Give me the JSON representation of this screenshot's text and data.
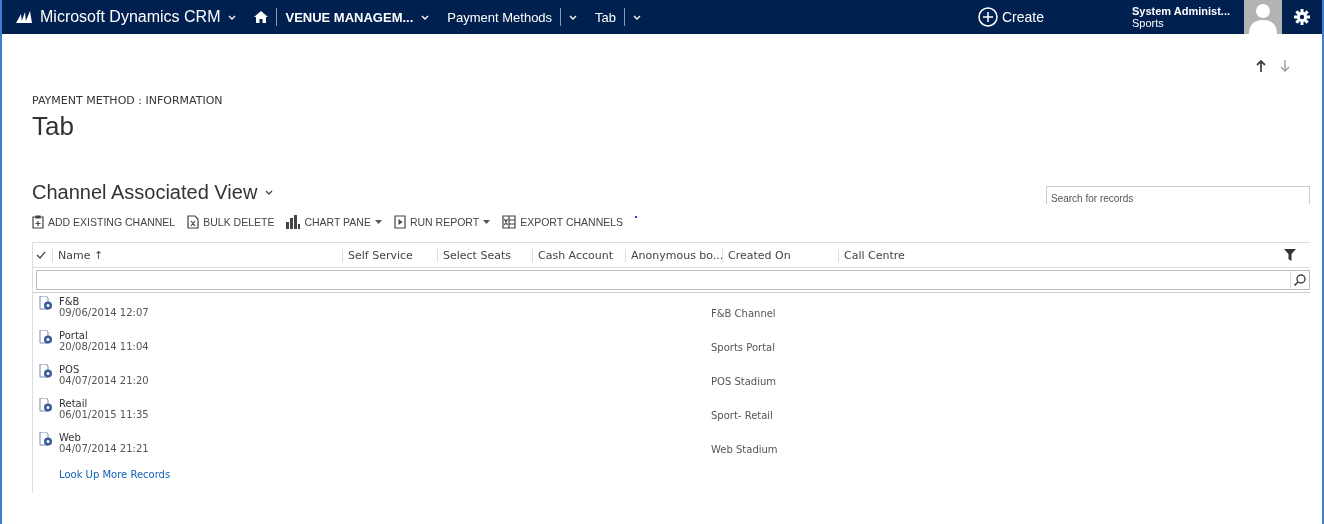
{
  "nav": {
    "app": "Microsoft Dynamics CRM",
    "area": "VENUE MANAGEM...",
    "entity": "Payment Methods",
    "record": "Tab",
    "create": "Create",
    "user": "System Administ...",
    "org": "Sports"
  },
  "record": {
    "entity_label": "PAYMENT METHOD : INFORMATION",
    "title": "Tab"
  },
  "view": {
    "title": "Channel Associated View",
    "search": {
      "placeholder": "Search for records"
    }
  },
  "commands": [
    {
      "label": "ADD EXISTING CHANNEL",
      "kind": "add",
      "dropdown": false
    },
    {
      "label": "BULK DELETE",
      "kind": "delete",
      "dropdown": false
    },
    {
      "label": "CHART PANE",
      "kind": "chart",
      "dropdown": true
    },
    {
      "label": "RUN REPORT",
      "kind": "report",
      "dropdown": true
    },
    {
      "label": "EXPORT CHANNELS",
      "kind": "export",
      "dropdown": false
    }
  ],
  "table": {
    "columns": [
      {
        "label": "Name ↑"
      },
      {
        "label": "Self Service"
      },
      {
        "label": "Select Seats"
      },
      {
        "label": "Cash Account"
      },
      {
        "label": "Anonymous bo..."
      },
      {
        "label": "Created On"
      },
      {
        "label": "Call Centre"
      }
    ],
    "rows": [
      {
        "name": "F&B",
        "date": "09/06/2014 12:07",
        "description": "F&B Channel"
      },
      {
        "name": "Portal",
        "date": "20/08/2014 11:04",
        "description": "Sports Portal"
      },
      {
        "name": "POS",
        "date": "04/07/2014 21:20",
        "description": "POS Stadium"
      },
      {
        "name": "Retail",
        "date": "06/01/2015 11:35",
        "description": "Sport- Retail"
      },
      {
        "name": "Web",
        "date": "04/07/2014 21:21",
        "description": "Web Stadium"
      }
    ],
    "more_link": "Look Up More Records"
  }
}
